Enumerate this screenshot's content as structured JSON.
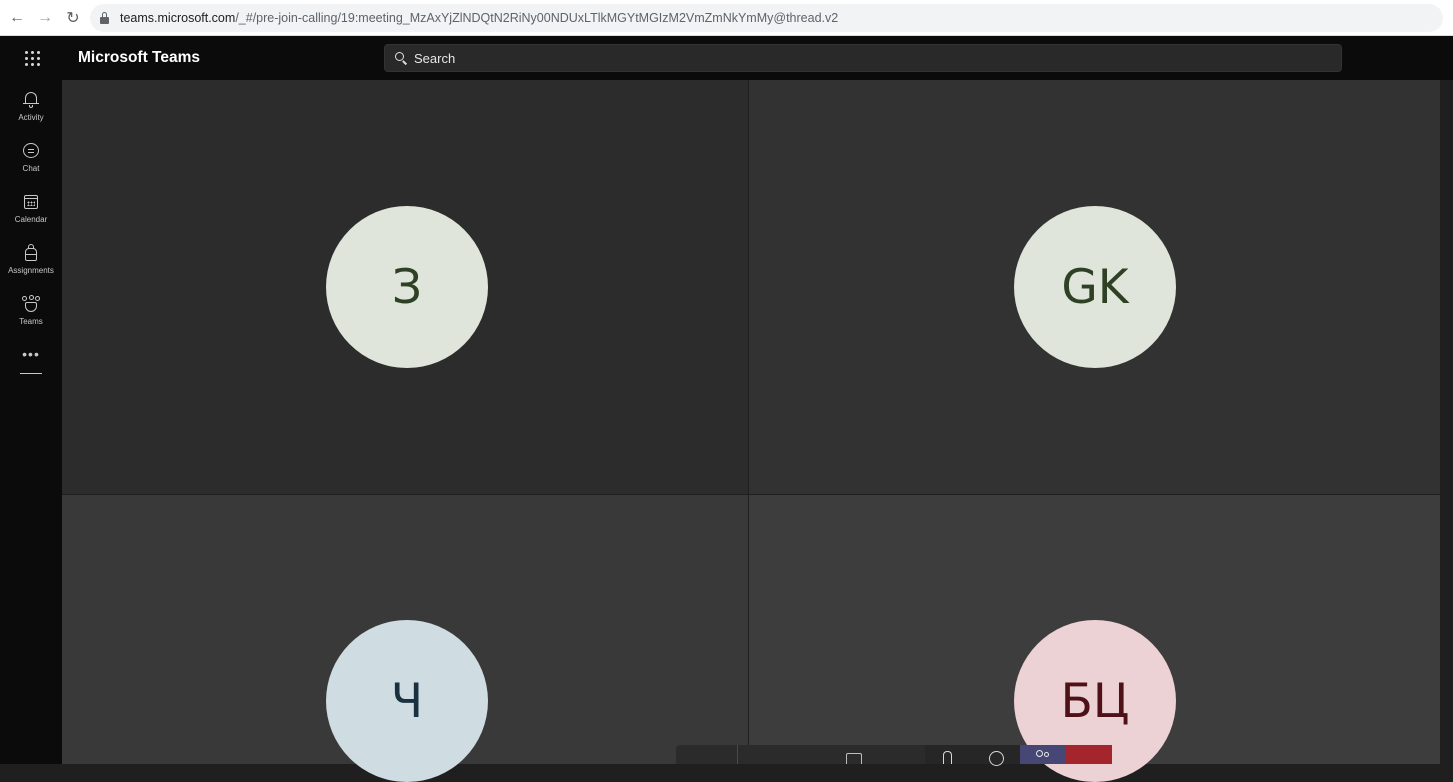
{
  "browser": {
    "url_host": "teams.microsoft.com",
    "url_path": "/_#/pre-join-calling/19:meeting_MzAxYjZlNDQtN2RiNy00NDUxLTlkMGYtMGIzM2VmZmNkYmMy@thread.v2"
  },
  "header": {
    "app_title": "Microsoft Teams",
    "search_placeholder": "Search"
  },
  "rail": {
    "items": [
      {
        "label": "Activity",
        "icon": "bell-icon"
      },
      {
        "label": "Chat",
        "icon": "chat-icon"
      },
      {
        "label": "Calendar",
        "icon": "calendar-icon"
      },
      {
        "label": "Assignments",
        "icon": "assignments-icon"
      },
      {
        "label": "Teams",
        "icon": "teams-icon"
      }
    ],
    "more": "•••"
  },
  "participants": [
    {
      "initials": "З",
      "avatar_bg": "#dfe5da",
      "avatar_fg": "#2f4125"
    },
    {
      "initials": "GK",
      "avatar_bg": "#dfe5da",
      "avatar_fg": "#2f4125"
    },
    {
      "initials": "Ч",
      "avatar_bg": "#cfdce2",
      "avatar_fg": "#1c3140"
    },
    {
      "initials": "БЦ",
      "avatar_bg": "#edd2d5",
      "avatar_fg": "#4d1117"
    }
  ],
  "colors": {
    "people_button": "#464775",
    "leave_button": "#a4262c"
  }
}
